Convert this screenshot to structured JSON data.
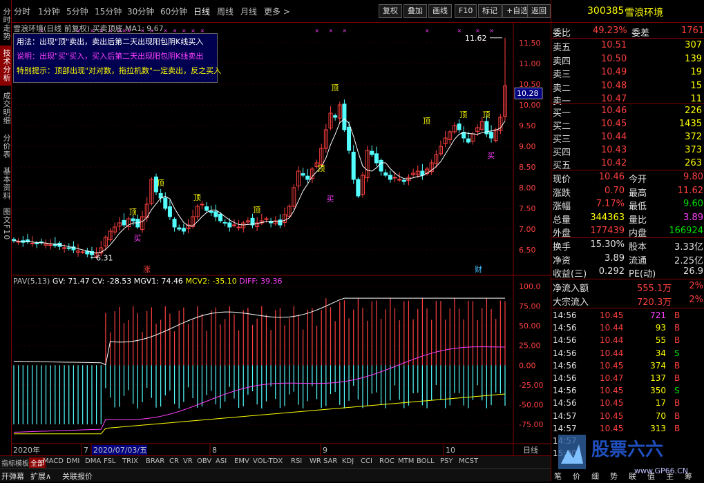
{
  "toolbar": {
    "periods": [
      "分时",
      "1分钟",
      "5分钟",
      "15分钟",
      "30分钟",
      "60分钟",
      "日线",
      "周线",
      "月线",
      "更多 >"
    ],
    "active_period": "日线",
    "buttons": [
      "复权",
      "叠加",
      "画线",
      "F10",
      "标记",
      "+自选",
      "返回"
    ]
  },
  "left_tabs": [
    "分时走势",
    "技术分析",
    "成交明细",
    "分价表",
    "基本资料",
    "图文F10"
  ],
  "active_left_tab": "技术分析",
  "chart": {
    "title": "雪浪环境(日线 前复权) 买卖顶底 MA1: 9.67",
    "info_lines": [
      {
        "text": "用法：出现\"顶\"卖出，卖出后第二天出现阳包阴K线买入",
        "color": "#ffffff"
      },
      {
        "text": "说明：出现\"买\"买入，买入后第二天出现阳包阴K线卖出",
        "color": "#ff40ff"
      },
      {
        "text": "特别提示：顶部出现\"对对数，拖拉机数\"一定卖出，反之买入",
        "color": "#ffff00"
      }
    ],
    "price_axis": [
      "11.50",
      "11.00",
      "10.50",
      "10.00",
      "9.50",
      "9.00",
      "8.50",
      "8.00",
      "7.50",
      "7.00",
      "6.50"
    ],
    "current_price_tag": "10.28",
    "high_label": "11.62",
    "low_label": "6.31",
    "markers": {
      "top": "顶",
      "buy": "买",
      "zhang": "涨",
      "cai": "财"
    },
    "indicator_title": {
      "name": "PAV(5,13)",
      "gv": "GV: 71.47",
      "cv": "CV: -28.53",
      "mgv1": "MGV1: 74.46",
      "mcv2": "MCV2: -35.10",
      "diff": "DIFF: 39.36"
    },
    "indicator_axis": [
      "100.0",
      "75.00",
      "50.00",
      "25.00",
      "0.00",
      "-25.00",
      "-50.00",
      "-75.00"
    ],
    "date_axis": {
      "labels": [
        "2020年",
        "7",
        "2020/07/03/五",
        "8",
        "9",
        "10"
      ],
      "right_label": "日线"
    }
  },
  "bottom_tabs": [
    "指标",
    "模板",
    "全部",
    "MACD",
    "DMI",
    "DMA",
    "FSL",
    "TRIX",
    "BRAR",
    "CR",
    "VR",
    "OBV",
    "ASI",
    "EMV",
    "VOL-TDX",
    "RSI",
    "WR",
    "SAR",
    "KDJ",
    "CCI",
    "ROC",
    "MTM",
    "BOLL",
    "PSY",
    "MCST"
  ],
  "active_bottom_tab": "全部",
  "status_buttons": [
    "开弹幕",
    "扩展∧",
    "关联报价"
  ],
  "quote": {
    "code": "300385",
    "name": "雪浪环境",
    "weibi_label": "委比",
    "weibi": "49.23%",
    "weicha_label": "委差",
    "weicha": "1761",
    "asks": [
      {
        "label": "卖五",
        "price": "10.51",
        "vol": "307"
      },
      {
        "label": "卖四",
        "price": "10.50",
        "vol": "139"
      },
      {
        "label": "卖三",
        "price": "10.49",
        "vol": "19"
      },
      {
        "label": "卖二",
        "price": "10.48",
        "vol": "15"
      },
      {
        "label": "卖一",
        "price": "10.47",
        "vol": "11"
      }
    ],
    "bids": [
      {
        "label": "买一",
        "price": "10.46",
        "vol": "226"
      },
      {
        "label": "买二",
        "price": "10.45",
        "vol": "1435"
      },
      {
        "label": "买三",
        "price": "10.44",
        "vol": "372"
      },
      {
        "label": "买四",
        "price": "10.43",
        "vol": "373"
      },
      {
        "label": "买五",
        "price": "10.42",
        "vol": "263"
      }
    ],
    "stats": [
      {
        "l1": "现价",
        "v1": "10.46",
        "c1": "red",
        "l2": "今开",
        "v2": "9.80",
        "c2": "red"
      },
      {
        "l1": "涨跌",
        "v1": "0.70",
        "c1": "red",
        "l2": "最高",
        "v2": "11.62",
        "c2": "red"
      },
      {
        "l1": "涨幅",
        "v1": "7.17%",
        "c1": "red",
        "l2": "最低",
        "v2": "9.60",
        "c2": "green"
      },
      {
        "l1": "总量",
        "v1": "344363",
        "c1": "yellow",
        "l2": "量比",
        "v2": "3.89",
        "c2": "magenta"
      },
      {
        "l1": "外盘",
        "v1": "177439",
        "c1": "red",
        "l2": "内盘",
        "v2": "166924",
        "c2": "green"
      }
    ],
    "stats2": [
      {
        "l1": "换手",
        "v1": "15.30%",
        "l2": "股本",
        "v2": "3.33亿"
      },
      {
        "l1": "净资",
        "v1": "3.89",
        "l2": "流通",
        "v2": "2.25亿"
      },
      {
        "l1": "收益(三)",
        "v1": "0.292",
        "l2": "PE(动)",
        "v2": "26.9"
      }
    ],
    "flows": [
      {
        "label": "净流入额",
        "value": "555.1万",
        "pct": "2%"
      },
      {
        "label": "大宗流入",
        "value": "720.3万",
        "pct": "2%"
      }
    ],
    "ticks": [
      {
        "t": "14:56",
        "p": "10.45",
        "v": "721",
        "s": "B",
        "pc": "red",
        "vc": "magenta"
      },
      {
        "t": "14:56",
        "p": "10.44",
        "v": "93",
        "s": "B",
        "pc": "red",
        "vc": "yellow"
      },
      {
        "t": "14:56",
        "p": "10.44",
        "v": "55",
        "s": "B",
        "pc": "red",
        "vc": "yellow"
      },
      {
        "t": "14:56",
        "p": "10.44",
        "v": "34",
        "s": "S",
        "pc": "red",
        "vc": "yellow"
      },
      {
        "t": "14:56",
        "p": "10.45",
        "v": "374",
        "s": "B",
        "pc": "red",
        "vc": "yellow"
      },
      {
        "t": "14:56",
        "p": "10.47",
        "v": "137",
        "s": "B",
        "pc": "red",
        "vc": "yellow"
      },
      {
        "t": "14:56",
        "p": "10.45",
        "v": "350",
        "s": "S",
        "pc": "red",
        "vc": "yellow"
      },
      {
        "t": "14:56",
        "p": "10.45",
        "v": "17",
        "s": "B",
        "pc": "red",
        "vc": "yellow"
      },
      {
        "t": "14:57",
        "p": "10.45",
        "v": "70",
        "s": "B",
        "pc": "red",
        "vc": "yellow"
      },
      {
        "t": "14:57",
        "p": "10.45",
        "v": "313",
        "s": "B",
        "pc": "red",
        "vc": "yellow"
      },
      {
        "t": "14:57",
        "p": "",
        "v": "",
        "s": "",
        "pc": "red",
        "vc": "yellow"
      },
      {
        "t": "15:00",
        "p": "",
        "v": "",
        "s": "",
        "pc": "red",
        "vc": "yellow"
      }
    ],
    "bottom_tabs": [
      "笔",
      "价",
      "细",
      "势",
      "联",
      "值",
      "主",
      "筹"
    ]
  },
  "watermark": {
    "brand": "股票六六",
    "url": "www.GP66.CN"
  },
  "colors": {
    "up": "#ff4040",
    "down": "#54ffff",
    "ma": "#ffffff",
    "frame": "#800000"
  }
}
